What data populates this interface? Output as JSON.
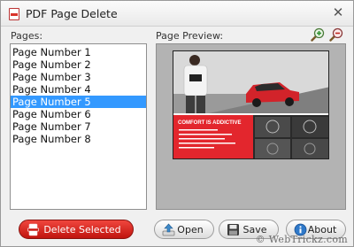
{
  "window": {
    "title": "PDF Page Delete"
  },
  "pages": {
    "label": "Pages:",
    "items": [
      "Page Number 1",
      "Page Number 2",
      "Page Number 3",
      "Page Number 4",
      "Page Number 5",
      "Page Number 6",
      "Page Number 7",
      "Page Number 8"
    ],
    "selected_index": 4
  },
  "preview": {
    "label": "Page Preview:",
    "page_text": "COMFORT IS ADDICTIVE"
  },
  "buttons": {
    "delete": "Delete Selected",
    "open": "Open",
    "save": "Save",
    "about": "About"
  },
  "watermark": "© WebTrickz.com",
  "colors": {
    "selection": "#3399ff",
    "delete_button": "#d9221a",
    "preview_background": "#b3b3b3",
    "preview_accent": "#e3262d"
  },
  "icons": {
    "close": "close-icon",
    "zoom_in": "zoom-in-icon",
    "zoom_out": "zoom-out-icon"
  }
}
